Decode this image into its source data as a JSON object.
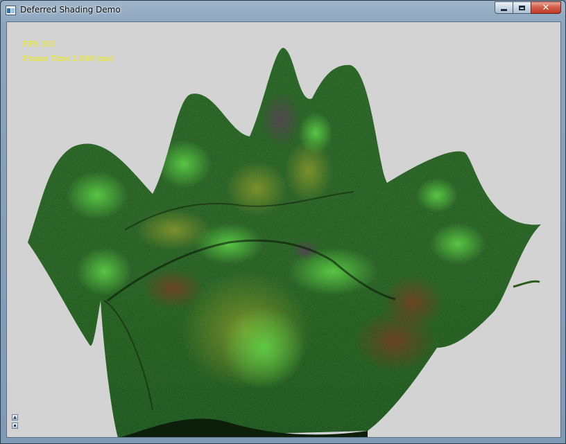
{
  "window": {
    "title": "Deferred Shading Demo",
    "icon": "application-window-icon"
  },
  "caption_buttons": {
    "minimize": "minimize-icon",
    "maximize": "maximize-icon",
    "close": "close-icon",
    "close_glyph": "✕"
  },
  "hud": {
    "fps": "FPS 351",
    "frame_time": "Frame Time 2.849 (ms)",
    "color": "#f0f000"
  },
  "viewport": {
    "background": "#d3d3d3",
    "content": "green-textured-wave-surface"
  },
  "corner_controls": {
    "up_glyph": "▲",
    "down_glyph": "▪"
  },
  "colors": {
    "surface_dark": "#0e200b",
    "surface_mid": "#2d5a1f",
    "surface_light": "#52c53c",
    "highlight_red": "#6b3320"
  }
}
